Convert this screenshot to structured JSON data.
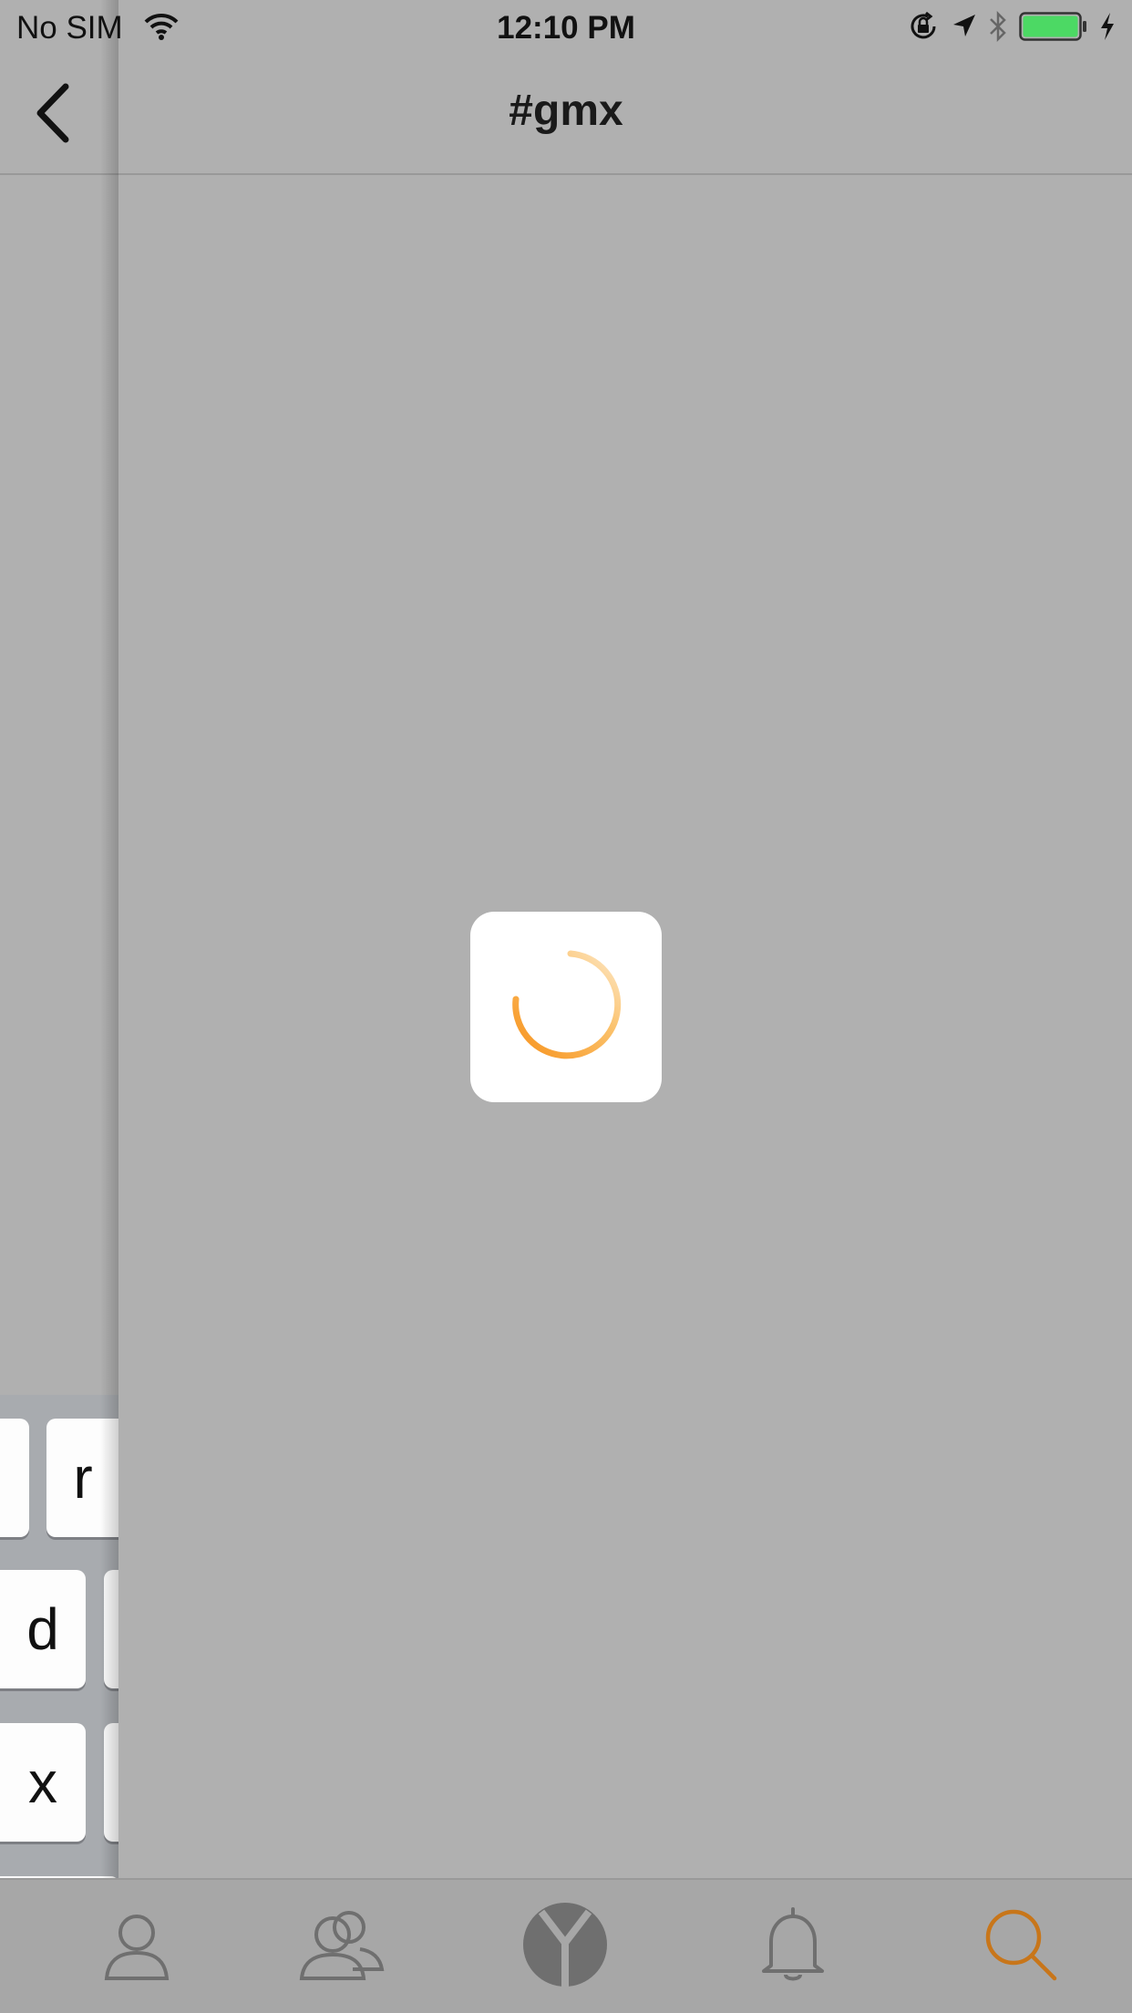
{
  "status_bar": {
    "carrier": "No SIM",
    "time": "12:10 PM",
    "icons": [
      "wifi-icon",
      "orientation-lock-icon",
      "location-arrow-icon",
      "bluetooth-icon",
      "battery-icon",
      "charging-bolt-icon"
    ],
    "battery_color": "#4cd964"
  },
  "nav": {
    "title": "#gmx",
    "back_icon": "chevron-left-icon"
  },
  "previous_screen_keyboard": {
    "visible_keys": [
      "r",
      "d",
      "x"
    ]
  },
  "loading": {
    "icon": "spinner-icon",
    "accent_color": "#f7931e"
  },
  "tab_bar": {
    "tabs": [
      {
        "icon": "profile-icon",
        "active": false
      },
      {
        "icon": "people-icon",
        "active": false
      },
      {
        "icon": "yammer-logo-icon",
        "active": false
      },
      {
        "icon": "bell-icon",
        "active": false
      },
      {
        "icon": "search-icon",
        "active": true
      }
    ],
    "active_color": "#c8761a",
    "inactive_color": "#6f6f6f"
  }
}
